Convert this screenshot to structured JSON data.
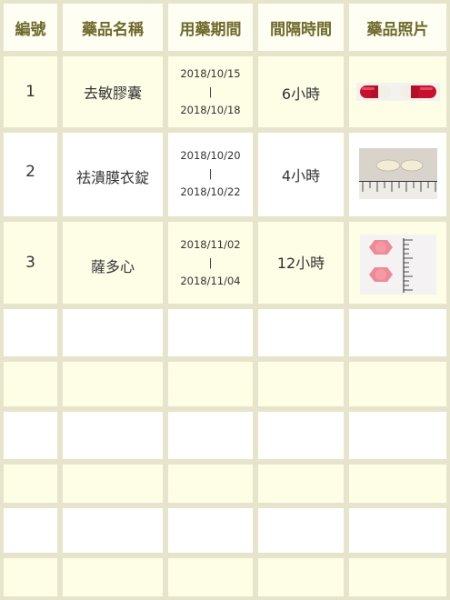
{
  "header": {
    "number": "編號",
    "drug_name": "藥品名稱",
    "period": "用藥期間",
    "interval": "間隔時間",
    "photo": "藥品照片"
  },
  "rows": [
    {
      "number": "1",
      "drug_name": "去敏膠囊",
      "start_date": "2018/10/15",
      "separator": "|",
      "end_date": "2018/10/18",
      "interval": "6小時",
      "photo": "red-white-capsules"
    },
    {
      "number": "2",
      "drug_name": "祛潰膜衣錠",
      "start_date": "2018/10/20",
      "separator": "|",
      "end_date": "2018/10/22",
      "interval": "4小時",
      "photo": "white-oval-tablets-with-ruler"
    },
    {
      "number": "3",
      "drug_name": "薩多心",
      "start_date": "2018/11/02",
      "separator": "|",
      "end_date": "2018/11/04",
      "interval": "12小時",
      "photo": "pink-round-tablets-with-ruler"
    }
  ],
  "colors": {
    "border": "#e6e5cc",
    "header_text": "#6e6a2c",
    "cream_row": "#fefee7",
    "white_row": "#ffffff"
  }
}
